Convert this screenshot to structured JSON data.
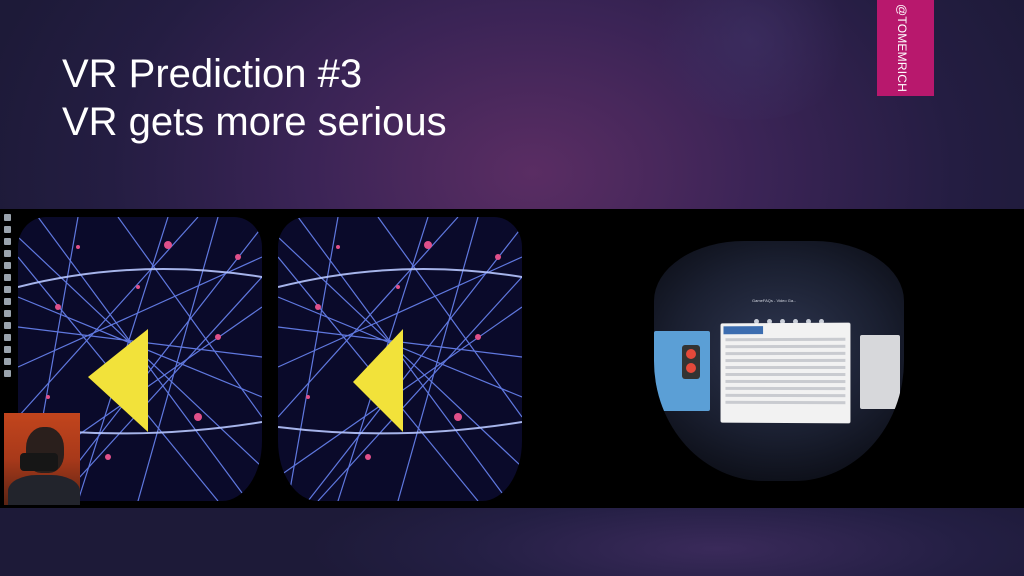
{
  "slide": {
    "title_line1": "VR Prediction #3",
    "title_line2": "VR gets more serious",
    "handle": "@TOMEMRICH"
  },
  "video": {
    "vr_browser_title": "GameFAQs - Video Ga..."
  },
  "colors": {
    "handle_tag": "#b8186d",
    "title_text": "#ffffff",
    "background": "#2a1f4a"
  }
}
